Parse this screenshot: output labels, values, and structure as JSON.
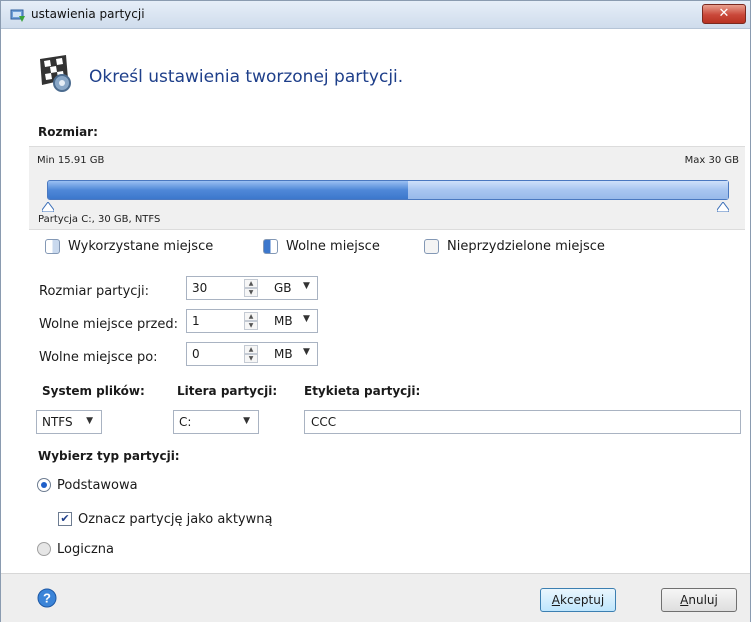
{
  "window": {
    "title": "ustawienia partycji",
    "close_label": "✕"
  },
  "header": {
    "title": "Określ ustawienia tworzonej partycji."
  },
  "size_section": {
    "label": "Rozmiar:",
    "min_label": "Min 15.91 GB",
    "max_label": "Max 30 GB",
    "partition_label": "Partycja C:, 30 GB, NTFS",
    "used_fraction": 0.53,
    "free_fraction": 0.47
  },
  "legend": {
    "used": "Wykorzystane miejsce",
    "free": "Wolne miejsce",
    "unallocated": "Nieprzydzielone miejsce"
  },
  "fields": {
    "partition_size": {
      "label": "Rozmiar partycji:",
      "value": "30",
      "unit": "GB"
    },
    "free_before": {
      "label": "Wolne miejsce przed:",
      "value": "1",
      "unit": "MB"
    },
    "free_after": {
      "label": "Wolne miejsce po:",
      "value": "0",
      "unit": "MB"
    }
  },
  "filesystem": {
    "label": "System plików:",
    "value": "NTFS"
  },
  "drive_letter": {
    "label": "Litera partycji:",
    "value": "C:"
  },
  "volume_label": {
    "label": "Etykieta partycji:",
    "value": "CCC"
  },
  "partition_type": {
    "label": "Wybierz typ partycji:",
    "primary": "Podstawowa",
    "mark_active": "Oznacz partycję jako aktywną",
    "logical": "Logiczna",
    "selected": "primary",
    "active_checked": true
  },
  "buttons": {
    "accept_first": "A",
    "accept_rest": "kceptuj",
    "cancel_first": "A",
    "cancel_rest": "nuluj"
  },
  "colors": {
    "title_text": "#1e3f8a",
    "bar_used": "#3c77cc",
    "bar_free": "#a8c5f0",
    "close_button": "#c9483a"
  }
}
